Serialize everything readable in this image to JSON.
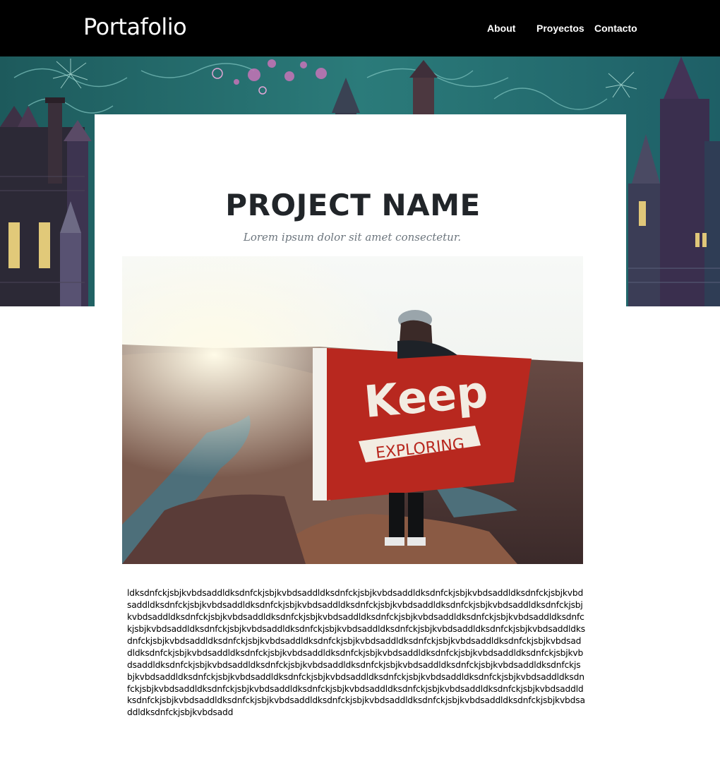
{
  "nav": {
    "brand": "Portafolio",
    "links": [
      "About",
      "Proyectos",
      "Contacto"
    ]
  },
  "project": {
    "title": "PROJECT NAME",
    "subtitle": "Lorem ipsum dolor sit amet consectetur.",
    "flag_text_top": "Keep",
    "flag_text_bottom": "EXPLORING",
    "body": "ldksdnfckjsbjkvbdsaddldksdnfckjsbjkvbdsaddldksdnfckjsbjkvbdsaddldksdnfckjsbjkvbdsaddldksdnfckjsbjkvbdsaddldksdnfckjsbjkvbdsaddldksdnfckjsbjkvbdsaddldksdnfckjsbjkvbdsaddldksdnfckjsbjkvbdsaddldksdnfckjsbjkvbdsaddldksdnfckjsbjkvbdsaddldksdnfckjsbjkvbdsaddldksdnfckjsbjkvbdsaddldksdnfckjsbjkvbdsaddldksdnfckjsbjkvbdsaddldksdnfckjsbjkvbdsaddldksdnfckjsbjkvbdsaddldksdnfckjsbjkvbdsaddldksdnfckjsbjkvbdsaddldksdnfckjsbjkvbdsaddldksdnfckjsbjkvbdsaddldksdnfckjsbjkvbdsaddldksdnfckjsbjkvbdsaddldksdnfckjsbjkvbdsaddldksdnfckjsbjkvbdsaddldksdnfckjsbjkvbdsaddldksdnfckjsbjkvbdsaddldksdnfckjsbjkvbdsaddldksdnfckjsbjkvbdsaddldksdnfckjsbjkvbdsaddldksdnfckjsbjkvbdsaddldksdnfckjsbjkvbdsaddldksdnfckjsbjkvbdsaddldksdnfckjsbjkvbdsaddldksdnfckjsbjkvbdsaddldksdnfckjsbjkvbdsaddldksdnfckjsbjkvbdsaddldksdnfckjsbjkvbdsaddldksdnfckjsbjkvbdsaddldksdnfckjsbjkvbdsaddldksdnfckjsbjkvbdsaddldksdnfckjsbjkvbdsaddldksdnfckjsbjkvbdsaddldksdnfckjsbjkvbdsaddldksdnfckjsbjkvbdsaddldksdnfckjsbjkvbdsaddldksdnfckjsbjkvbdsaddldksdnfckjsbjkvbdsaddldksdnfckjsbjkvbdsadd"
  },
  "colors": {
    "navbar": "#000000",
    "title": "#212529",
    "subtitle": "#6c757d",
    "flag_red": "#b8281f"
  }
}
